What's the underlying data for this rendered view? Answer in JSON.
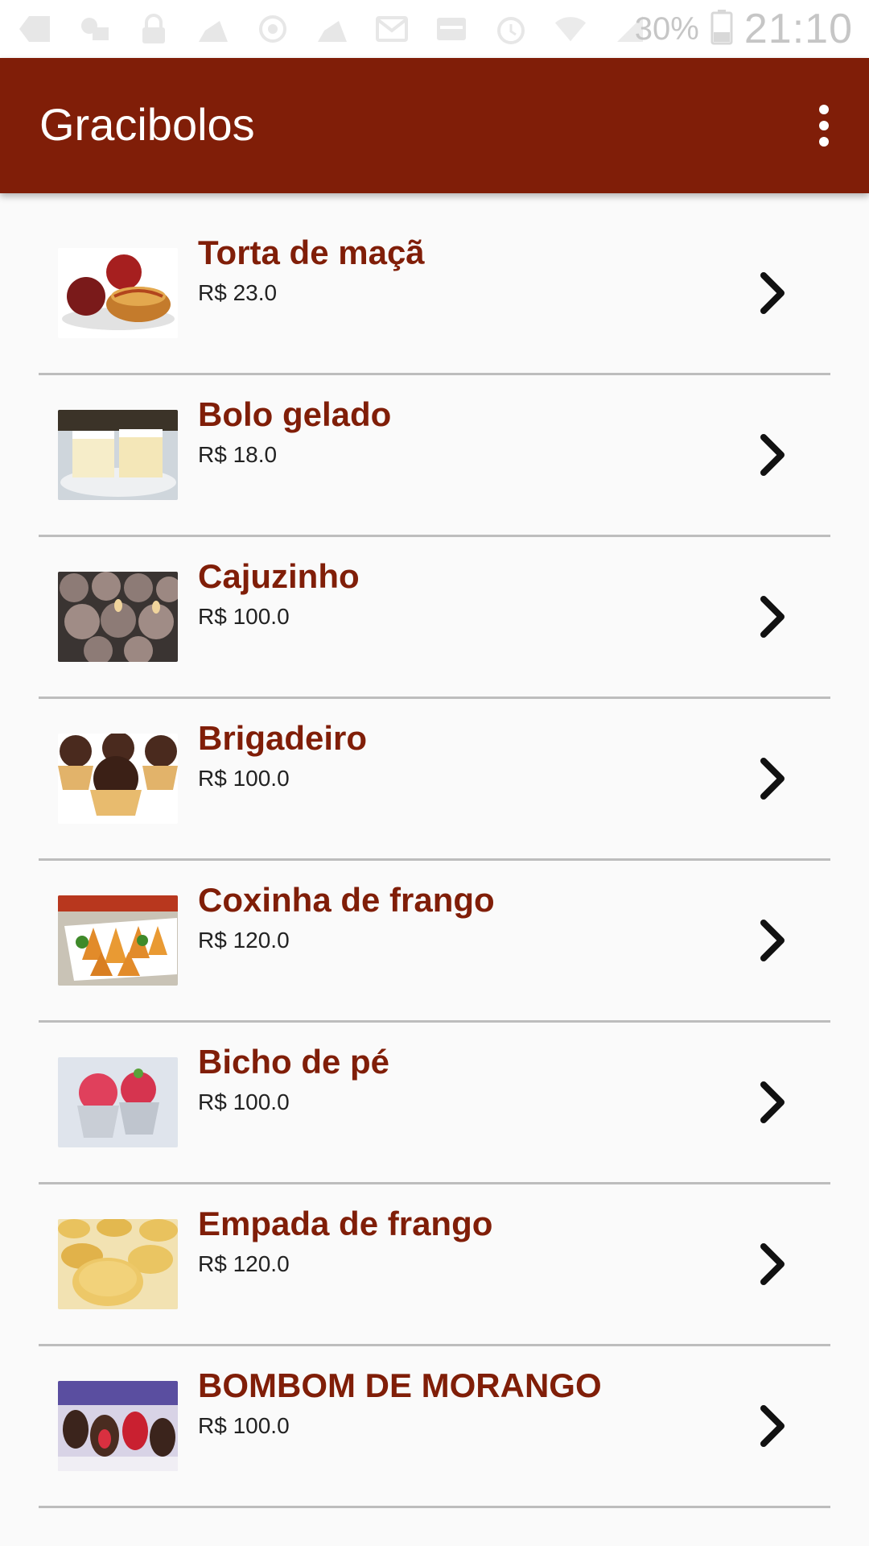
{
  "status_bar": {
    "icons": [
      "back-notification-icon",
      "mail-notification-icon",
      "lock-icon",
      "cake-icon",
      "sync-icon",
      "cake-icon",
      "gmail-icon",
      "card-icon",
      "alarm-icon",
      "wifi-icon",
      "signal-icon"
    ],
    "battery": "30%",
    "time": "21:10"
  },
  "app_bar": {
    "title": "Gracibolos",
    "menu_icon": "more-vert-icon",
    "background": "#801e08"
  },
  "colors": {
    "accent": "#801e08",
    "divider": "#bdbdbd",
    "background": "#fafafa"
  },
  "products": [
    {
      "name": "Torta de maçã",
      "price": "R$ 23.0",
      "image": "apple-pie-photo"
    },
    {
      "name": "Bolo gelado",
      "price": "R$ 18.0",
      "image": "iced-cake-photo"
    },
    {
      "name": "Cajuzinho",
      "price": "R$ 100.0",
      "image": "cajuzinho-photo"
    },
    {
      "name": "Brigadeiro",
      "price": "R$ 100.0",
      "image": "brigadeiro-photo"
    },
    {
      "name": "Coxinha de frango",
      "price": "R$ 120.0",
      "image": "coxinha-photo"
    },
    {
      "name": "Bicho de pé",
      "price": "R$ 100.0",
      "image": "bicho-de-pe-photo"
    },
    {
      "name": "Empada de frango",
      "price": "R$ 120.0",
      "image": "empada-photo"
    },
    {
      "name": "BOMBOM DE MORANGO",
      "price": "R$ 100.0",
      "image": "strawberry-bonbon-photo"
    }
  ],
  "row_arrow_icon": "chevron-right-icon"
}
